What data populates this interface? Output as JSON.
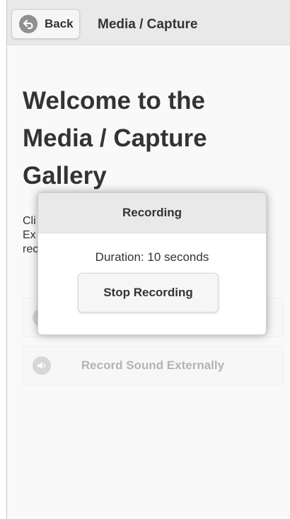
{
  "header": {
    "back_label": "Back",
    "title": "Media / Capture"
  },
  "main": {
    "welcome_title": "Welcome to the Media / Capture Gallery",
    "description_visible": "Cli                                                   d\nEx\nrec"
  },
  "buttons": [
    {
      "label": "",
      "icon": "record-icon"
    },
    {
      "label": "Record Sound Externally",
      "icon": "speaker-icon"
    }
  ],
  "dialog": {
    "title": "Recording",
    "duration_text": "Duration: 10 seconds",
    "stop_label": "Stop Recording"
  },
  "colors": {
    "header_bg": "#e9e9e9",
    "page_bg": "#f9f9f9",
    "text": "#333333",
    "icon_gray": "#8f8f8f"
  }
}
